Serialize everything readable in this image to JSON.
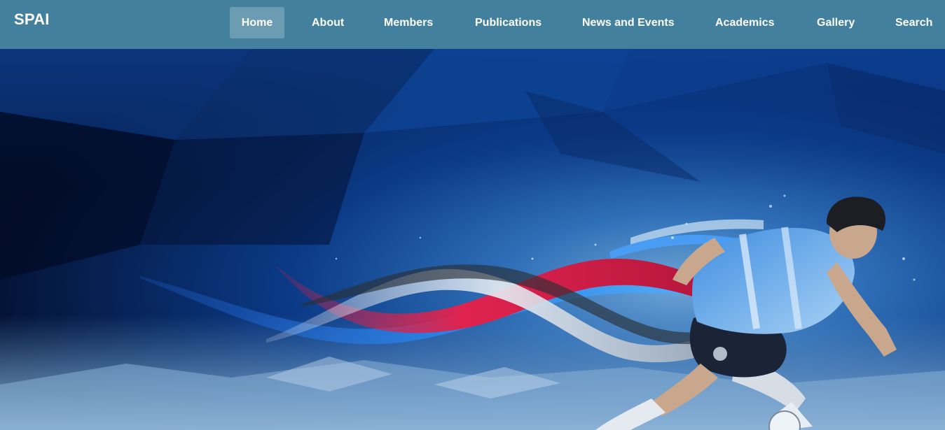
{
  "header": {
    "brand": "SPAI",
    "nav": [
      {
        "label": "Home",
        "active": true
      },
      {
        "label": "About",
        "active": false
      },
      {
        "label": "Members",
        "active": false
      },
      {
        "label": "Publications",
        "active": false
      },
      {
        "label": "News and Events",
        "active": false
      },
      {
        "label": "Academics",
        "active": false
      },
      {
        "label": "Gallery",
        "active": false
      },
      {
        "label": "Search",
        "active": false
      }
    ]
  },
  "hero": {
    "image": "soccer-player-with-flag-ribbons-illustration"
  },
  "colors": {
    "navbar": "#43809d",
    "hero_dark": "#041235",
    "hero_mid": "#0b3d8c",
    "ribbon_red": "#d11c46",
    "ribbon_blue": "#1e7be0",
    "ribbon_white": "#e8edf3"
  }
}
